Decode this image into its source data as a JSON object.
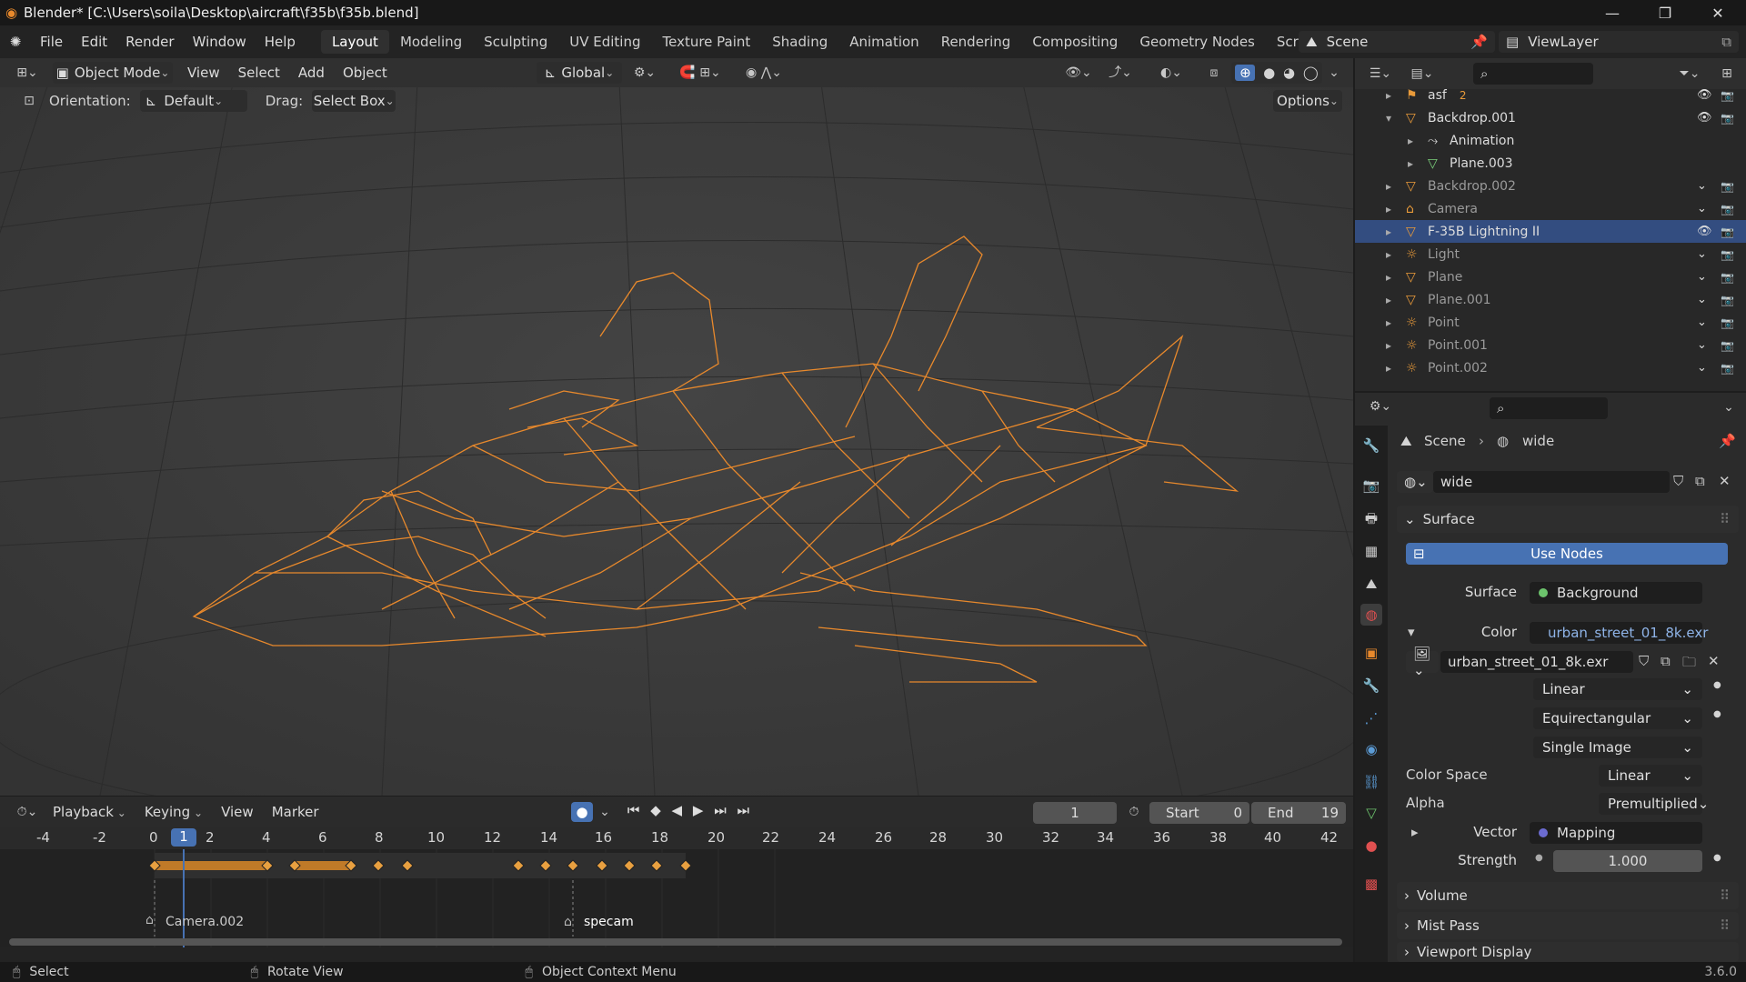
{
  "window": {
    "title": "Blender* [C:\\Users\\soila\\Desktop\\aircraft\\f35b\\f35b.blend]",
    "minimize": "—",
    "maximize": "❐",
    "close": "✕"
  },
  "menu": {
    "items": [
      "File",
      "Edit",
      "Render",
      "Window",
      "Help"
    ]
  },
  "workspaces": [
    "Layout",
    "Modeling",
    "Sculpting",
    "UV Editing",
    "Texture Paint",
    "Shading",
    "Animation",
    "Rendering",
    "Compositing",
    "Geometry Nodes",
    "Scripting"
  ],
  "scene": {
    "name": "Scene",
    "view_layer": "ViewLayer"
  },
  "viewport": {
    "mode": "Object Mode",
    "menu": [
      "View",
      "Select",
      "Add",
      "Object"
    ],
    "transform": "Global",
    "orientation_label": "Orientation:",
    "orientation": "Default",
    "drag_label": "Drag:",
    "drag": "Select Box",
    "options": "Options"
  },
  "timeline": {
    "menu": [
      "Playback",
      "Keying",
      "View",
      "Marker"
    ],
    "current_frame": "1",
    "start_label": "Start",
    "start": "0",
    "end_label": "End",
    "end": "19",
    "ruler": [
      "-4",
      "-2",
      "0",
      "1",
      "2",
      "4",
      "6",
      "8",
      "10",
      "12",
      "14",
      "16",
      "18",
      "20",
      "22",
      "24",
      "26",
      "28",
      "30",
      "32",
      "34",
      "36",
      "38",
      "40",
      "42"
    ],
    "markers": [
      "Camera.002",
      "specam"
    ]
  },
  "outliner": {
    "rows": [
      {
        "label": "asf",
        "badge": "2",
        "icon": "armature",
        "color": "#e89a3a"
      },
      {
        "label": "Backdrop.001",
        "icon": "mesh",
        "color": "#e89a3a"
      },
      {
        "label": "Animation",
        "icon": "anim",
        "color": "#cfcfcf"
      },
      {
        "label": "Plane.003",
        "icon": "mesh",
        "color": "#7bd07b"
      },
      {
        "label": "Backdrop.002",
        "icon": "mesh",
        "color": "#e89a3a"
      },
      {
        "label": "Camera",
        "icon": "camera",
        "color": "#e89a3a"
      },
      {
        "label": "F-35B Lightning II",
        "icon": "mesh",
        "color": "#e89a3a"
      },
      {
        "label": "Light",
        "icon": "light",
        "color": "#e89a3a"
      },
      {
        "label": "Plane",
        "icon": "mesh",
        "color": "#e89a3a"
      },
      {
        "label": "Plane.001",
        "icon": "mesh",
        "color": "#e89a3a"
      },
      {
        "label": "Point",
        "icon": "light",
        "color": "#e89a3a"
      },
      {
        "label": "Point.001",
        "icon": "light",
        "color": "#e89a3a"
      },
      {
        "label": "Point.002",
        "icon": "light",
        "color": "#e89a3a"
      }
    ]
  },
  "properties": {
    "breadcrumb": [
      "Scene",
      "wide"
    ],
    "world_name": "wide",
    "surface_panel": "Surface",
    "use_nodes": "Use Nodes",
    "surface_label": "Surface",
    "surface_value": "Background",
    "color_label": "Color",
    "color_value": "urban_street_01_8k.exr",
    "image_name": "urban_street_01_8k.exr",
    "interpolation": "Linear",
    "projection": "Equirectangular",
    "source": "Single Image",
    "color_space_label": "Color Space",
    "color_space": "Linear",
    "alpha_label": "Alpha",
    "alpha": "Premultiplied",
    "vector_label": "Vector",
    "vector_value": "Mapping",
    "strength_label": "Strength",
    "strength": "1.000",
    "panels": [
      "Volume",
      "Mist Pass",
      "Viewport Display"
    ]
  },
  "status": {
    "select": "Select",
    "rotate": "Rotate View",
    "context": "Object Context Menu",
    "version": "3.6.0"
  }
}
